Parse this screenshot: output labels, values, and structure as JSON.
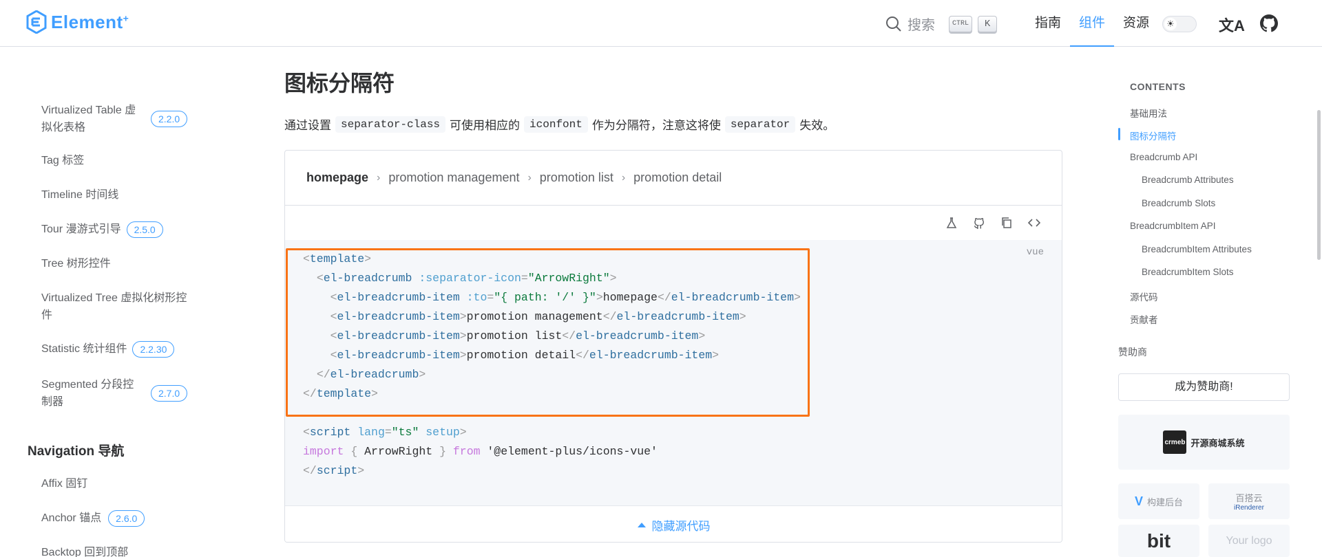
{
  "header": {
    "logo_text": "Element",
    "logo_sup": "+",
    "search_placeholder": "搜索",
    "kbd_ctrl": "CTRL",
    "kbd_k": "K",
    "nav": [
      {
        "label": "指南"
      },
      {
        "label": "组件"
      },
      {
        "label": "资源"
      }
    ],
    "lang_icon": "文A",
    "brand_color": "#409eff"
  },
  "sidebar": {
    "items": [
      {
        "label": "Virtualized Table 虚拟化表格",
        "badge": "2.2.0"
      },
      {
        "label": "Tag 标签",
        "badge": ""
      },
      {
        "label": "Timeline 时间线",
        "badge": ""
      },
      {
        "label": "Tour 漫游式引导",
        "badge": "2.5.0"
      },
      {
        "label": "Tree 树形控件",
        "badge": ""
      },
      {
        "label": "Virtualized Tree 虚拟化树形控件",
        "badge": ""
      },
      {
        "label": "Statistic 统计组件",
        "badge": "2.2.30"
      },
      {
        "label": "Segmented 分段控制器",
        "badge": "2.7.0"
      }
    ],
    "group_title": "Navigation 导航",
    "nav_items": [
      {
        "label": "Affix 固钉",
        "badge": ""
      },
      {
        "label": "Anchor 锚点",
        "badge": "2.6.0"
      },
      {
        "label": "Backtop 回到顶部",
        "badge": ""
      }
    ]
  },
  "main": {
    "title": "图标分隔符",
    "desc_1": "通过设置",
    "chip_1": "separator-class",
    "desc_2": "可使用相应的",
    "chip_2": "iconfont",
    "desc_3": "作为分隔符，注意这将使",
    "chip_3": "separator",
    "desc_4": "失效。",
    "breadcrumb": [
      "homepage",
      "promotion management",
      "promotion list",
      "promotion detail"
    ],
    "code_lang": "vue",
    "code": {
      "l1_tag": "template",
      "l2_tag": "el-breadcrumb",
      "l2_attr": ":separator-icon",
      "l2_val": "\"ArrowRight\"",
      "l3_tag": "el-breadcrumb-item",
      "l3_attr": ":to",
      "l3_val": "\"{ path: '/' }\"",
      "l3_text": "homepage",
      "l4_text": "promotion management",
      "l5_text": "promotion list",
      "l6_text": "promotion detail",
      "l9_tag": "script",
      "l9_attr": "lang",
      "l9_val": "\"ts\"",
      "l9_attr2": "setup",
      "l10_kw": "import",
      "l10_name": "ArrowRight",
      "l10_from": "from",
      "l10_src": "'@element-plus/icons-vue'"
    },
    "hide_code": "隐藏源代码"
  },
  "toc": {
    "title": "CONTENTS",
    "items": [
      {
        "label": "基础用法"
      },
      {
        "label": "图标分隔符"
      },
      {
        "label": "Breadcrumb API"
      },
      {
        "label": "Breadcrumb Attributes"
      },
      {
        "label": "Breadcrumb Slots"
      },
      {
        "label": "BreadcrumbItem API"
      },
      {
        "label": "BreadcrumbItem Attributes"
      },
      {
        "label": "BreadcrumbItem Slots"
      },
      {
        "label": "源代码"
      },
      {
        "label": "贡献者"
      }
    ]
  },
  "sponsors": {
    "title": "赞助商",
    "become": "成为赞助商!",
    "crmeb_mark": "crmeb",
    "crmeb": "开源商城系统",
    "vform": "构建后台",
    "baidu": "百搭云",
    "irenderer": "iRenderer",
    "bit": "bit",
    "your_logo": "Your logo"
  }
}
